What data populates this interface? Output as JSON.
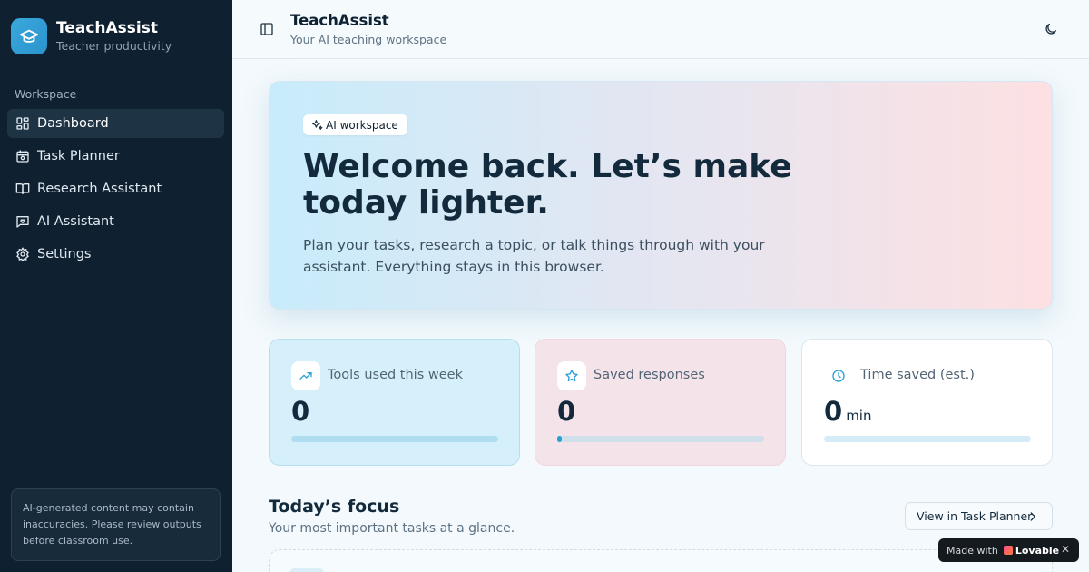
{
  "sidebar": {
    "brand": {
      "title": "TeachAssist",
      "subtitle": "Teacher productivity"
    },
    "section_label": "Workspace",
    "items": [
      {
        "label": "Dashboard",
        "icon": "dashboard-icon",
        "active": true
      },
      {
        "label": "Task Planner",
        "icon": "calendar-icon"
      },
      {
        "label": "Research Assistant",
        "icon": "book-open-icon"
      },
      {
        "label": "AI Assistant",
        "icon": "chat-bubble-icon"
      },
      {
        "label": "Settings",
        "icon": "gear-icon"
      }
    ],
    "disclaimer": "AI-generated content may contain inaccuracies. Please review outputs before classroom use."
  },
  "topbar": {
    "title": "TeachAssist",
    "subtitle": "Your AI teaching workspace",
    "toggle_icon": "sidebar-toggle-icon",
    "theme_icon": "moon-icon"
  },
  "hero": {
    "badge": "AI workspace",
    "title": "Welcome back. Let’s make today lighter.",
    "text": "Plan your tasks, research a topic, or talk things through with your assistant. Everything stays in this browser."
  },
  "stats": [
    {
      "label": "Tools used this week",
      "value": "0",
      "unit": "",
      "icon": "trending-up-icon",
      "progress": 0
    },
    {
      "label": "Saved responses",
      "value": "0",
      "unit": "",
      "icon": "star-icon",
      "progress": 0.02
    },
    {
      "label": "Time saved (est.)",
      "value": "0",
      "unit": "min",
      "icon": "clock-icon",
      "progress": 0
    }
  ],
  "focus": {
    "title": "Today’s focus",
    "subtitle": "Your most important tasks at a glance.",
    "button": "View in Task Planner"
  },
  "made_with": {
    "prefix": "Made with",
    "brand": "Lovable",
    "close": "✕"
  },
  "colors": {
    "accent": "#2a9fd6",
    "sidebar": "#0f2130",
    "hero_left": "#c8ecfb",
    "hero_right": "#fde0e2"
  }
}
